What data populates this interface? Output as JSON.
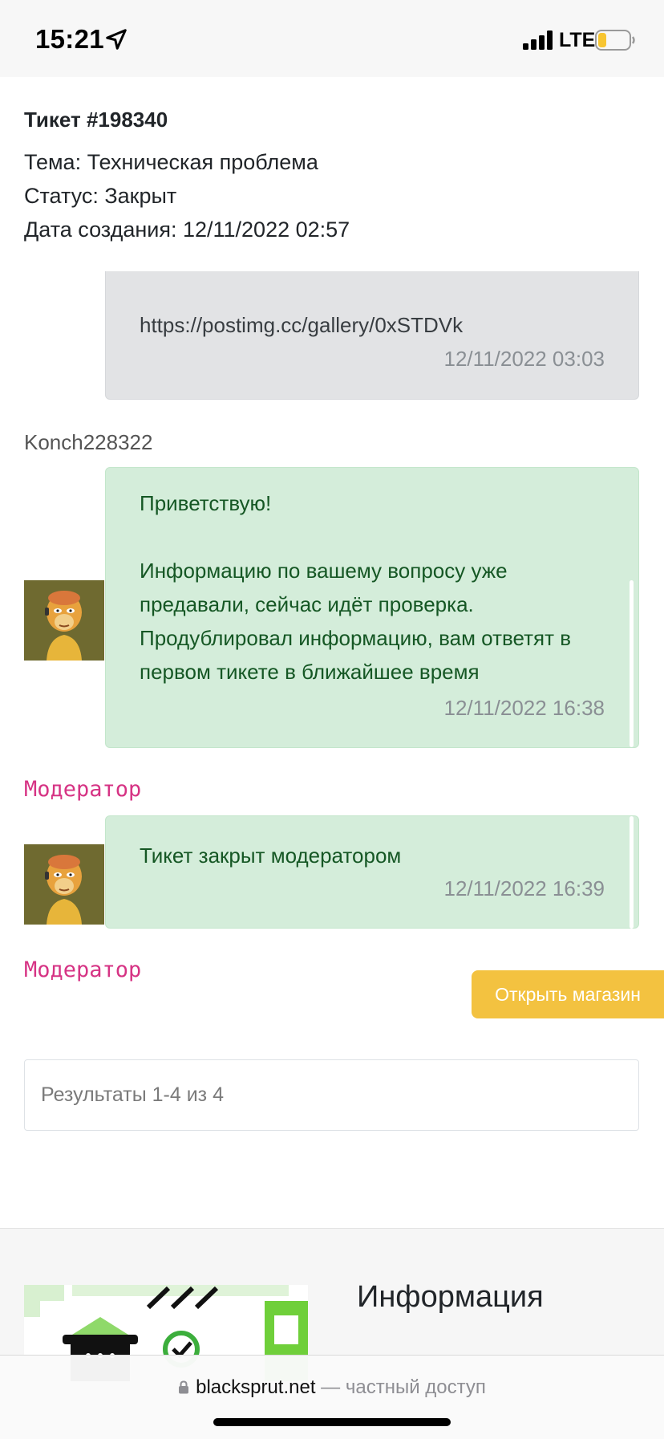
{
  "status_bar": {
    "time": "15:21",
    "network": "LTE"
  },
  "ticket": {
    "title": "Тикет #198340",
    "subject": "Тема: Техническая проблема",
    "status": "Статус: Закрыт",
    "created": "Дата создания: 12/11/2022 02:57"
  },
  "messages": [
    {
      "text": "https://postimg.cc/gallery/0xSTDVk",
      "time": "12/11/2022 03:03",
      "author": "Konch228322"
    },
    {
      "text": "Приветствую!\n\nИнформацию по вашему вопросу уже предавали, сейчас идёт проверка. Продублировал информацию, вам ответят в первом тикете в ближайшее время",
      "time": "12/11/2022 16:38",
      "author": "Модератор"
    },
    {
      "text": "Тикет закрыт модератором",
      "time": "12/11/2022 16:39",
      "author": "Модератор"
    }
  ],
  "open_shop_label": "Открыть магазин",
  "pagination": {
    "results_text": "Результаты 1-4 из 4"
  },
  "footer": {
    "heading": "Информация"
  },
  "browser": {
    "host": "blacksprut.net",
    "suffix": " — частный доступ"
  },
  "colors": {
    "accent_yellow": "#f3c240",
    "moderator_pink": "#d63384",
    "success_bg": "#d4edda",
    "success_text": "#155724"
  }
}
